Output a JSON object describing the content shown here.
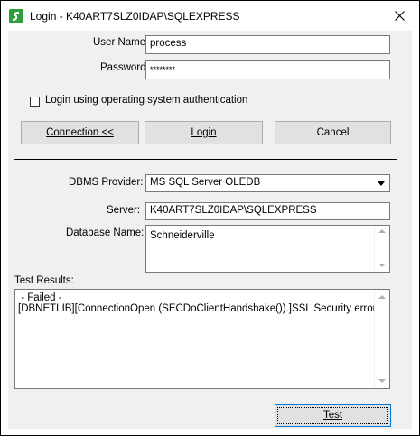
{
  "window": {
    "title": "Login - K40ART7SLZ0IDAP\\SQLEXPRESS"
  },
  "login": {
    "username_label": "User Name:",
    "username_value": "process",
    "password_label": "Password:",
    "password_value": "********",
    "os_auth_label": "Login using operating system authentication",
    "os_auth_checked": false
  },
  "buttons": {
    "connection_label": "Connection <<",
    "login_label": "Login",
    "cancel_label": "Cancel",
    "test_label": "Test"
  },
  "connection": {
    "dbms_label": "DBMS Provider:",
    "dbms_value": "MS SQL Server OLEDB",
    "server_label": "Server:",
    "server_value": "K40ART7SLZ0IDAP\\SQLEXPRESS",
    "database_label": "Database Name:",
    "database_value": "Schneiderville"
  },
  "test": {
    "results_label": "Test Results:",
    "line1": " - Failed -",
    "line2": "[DBNETLIB][ConnectionOpen (SECDoClientHandshake()).]SSL Security error."
  },
  "icons": {
    "app": "schneider-logo-icon",
    "close": "close-icon"
  }
}
